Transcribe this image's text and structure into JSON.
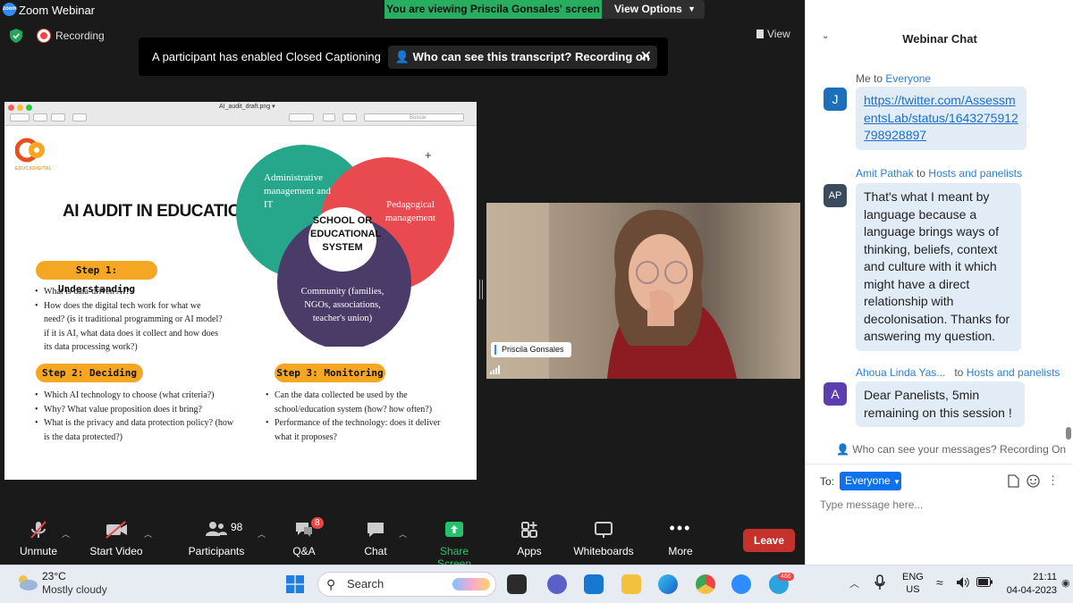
{
  "window": {
    "title": "Zoom Webinar",
    "minimize": "—",
    "restore": "❐",
    "close": "✕"
  },
  "share_banner": {
    "text": "You are viewing Priscila Gonsales' screen",
    "view_options": "View Options"
  },
  "status": {
    "recording": "Recording",
    "view": "View"
  },
  "caption_banner": {
    "text": "A participant has enabled Closed Captioning",
    "who": "Who can see this transcript? Recording on"
  },
  "shared_window": {
    "file_name": "AI_audit_draft.png ▾",
    "search_placeholder": "Buscar",
    "slide": {
      "logo_text": "EDUCADIGITAL",
      "title": "AI AUDIT IN EDUCATION",
      "venn": {
        "admin": "Administrative management and IT",
        "pedagogical": "Pedagogical management",
        "center": "SCHOOL OR EDUCATIONAL SYSTEM",
        "community": "Community (families, NGOs, associations, teacher's union)"
      },
      "step1": {
        "label": "Step 1: Understanding",
        "bullets": [
          "What is data-driven AI?",
          "How does the digital tech work for what we need? (is it traditional programming or AI model? if it is AI, what data does it collect and how does its data processing work?)"
        ]
      },
      "step2": {
        "label": "Step 2: Deciding",
        "bullets": [
          "Which AI technology to choose (what criteria?)",
          "Why? What value proposition does it bring?",
          "What is the privacy and data protection policy? (how is the data protected?)"
        ]
      },
      "step3": {
        "label": "Step 3: Monitoring",
        "bullets": [
          "Can the data collected be used by the school/education system (how? how often?)",
          "Performance of the technology: does it deliver what it proposes?"
        ]
      },
      "plus": "+"
    }
  },
  "video": {
    "name": "Priscila Gonsales"
  },
  "toolbar": {
    "unmute": "Unmute",
    "start_video": "Start Video",
    "participants": "Participants",
    "participants_count": "98",
    "qa": "Q&A",
    "qa_badge": "8",
    "chat": "Chat",
    "share_screen": "Share Screen",
    "apps": "Apps",
    "whiteboards": "Whiteboards",
    "more": "More",
    "leave": "Leave"
  },
  "chat": {
    "title": "Webinar Chat",
    "messages": [
      {
        "from": "Me",
        "to_word": "to",
        "to": "Everyone",
        "avatar": "J",
        "avatar_color": "#1f6fb8",
        "text": "https://twitter.com/AssessmentsLab/status/1643275912798928897"
      },
      {
        "from": "Amit Pathak",
        "to_word": "to",
        "to": "Hosts and panelists",
        "avatar": "AP",
        "avatar_color": "#3b4b5e",
        "text": "That's what I meant by language because a language brings ways of thinking, beliefs, context and culture with it which might have a direct relationship with decolonisation. Thanks for answering my question."
      },
      {
        "from": "Ahoua Linda Yas...",
        "to_word": "to",
        "to": "Hosts and panelists",
        "avatar": "A",
        "avatar_color": "#5b3fb0",
        "text": "Dear Panelists, 5min remaining on this session !"
      }
    ],
    "who_can_see": "Who can see your messages? Recording On",
    "to_label": "To:",
    "to_value": "Everyone",
    "input_placeholder": "Type message here..."
  },
  "taskbar": {
    "temperature": "23°C",
    "weather": "Mostly cloudy",
    "search": "Search",
    "lang_top": "ENG",
    "lang_bottom": "US",
    "time": "21:11",
    "date": "04-04-2023",
    "telegram_badge": "466"
  }
}
